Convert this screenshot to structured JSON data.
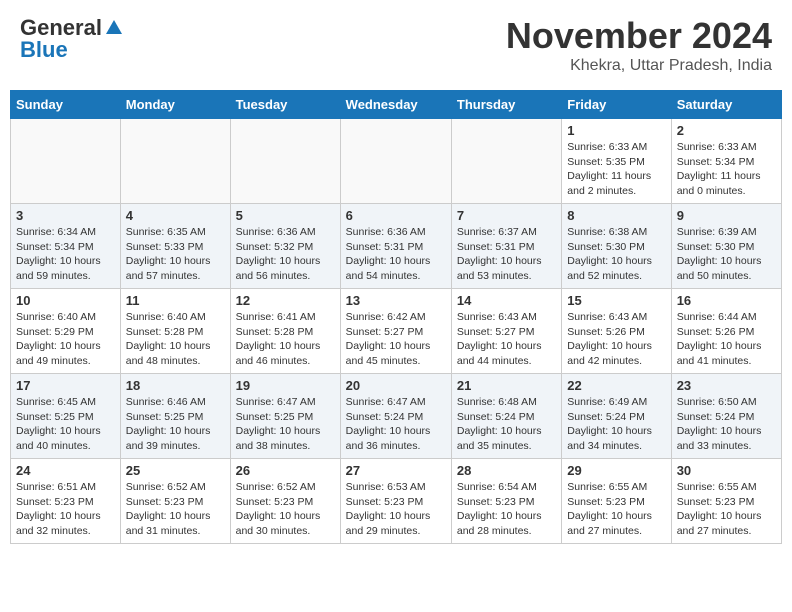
{
  "header": {
    "logo_line1": "General",
    "logo_line2": "Blue",
    "month": "November 2024",
    "location": "Khekra, Uttar Pradesh, India"
  },
  "weekdays": [
    "Sunday",
    "Monday",
    "Tuesday",
    "Wednesday",
    "Thursday",
    "Friday",
    "Saturday"
  ],
  "weeks": [
    [
      {
        "day": "",
        "info": ""
      },
      {
        "day": "",
        "info": ""
      },
      {
        "day": "",
        "info": ""
      },
      {
        "day": "",
        "info": ""
      },
      {
        "day": "",
        "info": ""
      },
      {
        "day": "1",
        "info": "Sunrise: 6:33 AM\nSunset: 5:35 PM\nDaylight: 11 hours and 2 minutes."
      },
      {
        "day": "2",
        "info": "Sunrise: 6:33 AM\nSunset: 5:34 PM\nDaylight: 11 hours and 0 minutes."
      }
    ],
    [
      {
        "day": "3",
        "info": "Sunrise: 6:34 AM\nSunset: 5:34 PM\nDaylight: 10 hours and 59 minutes."
      },
      {
        "day": "4",
        "info": "Sunrise: 6:35 AM\nSunset: 5:33 PM\nDaylight: 10 hours and 57 minutes."
      },
      {
        "day": "5",
        "info": "Sunrise: 6:36 AM\nSunset: 5:32 PM\nDaylight: 10 hours and 56 minutes."
      },
      {
        "day": "6",
        "info": "Sunrise: 6:36 AM\nSunset: 5:31 PM\nDaylight: 10 hours and 54 minutes."
      },
      {
        "day": "7",
        "info": "Sunrise: 6:37 AM\nSunset: 5:31 PM\nDaylight: 10 hours and 53 minutes."
      },
      {
        "day": "8",
        "info": "Sunrise: 6:38 AM\nSunset: 5:30 PM\nDaylight: 10 hours and 52 minutes."
      },
      {
        "day": "9",
        "info": "Sunrise: 6:39 AM\nSunset: 5:30 PM\nDaylight: 10 hours and 50 minutes."
      }
    ],
    [
      {
        "day": "10",
        "info": "Sunrise: 6:40 AM\nSunset: 5:29 PM\nDaylight: 10 hours and 49 minutes."
      },
      {
        "day": "11",
        "info": "Sunrise: 6:40 AM\nSunset: 5:28 PM\nDaylight: 10 hours and 48 minutes."
      },
      {
        "day": "12",
        "info": "Sunrise: 6:41 AM\nSunset: 5:28 PM\nDaylight: 10 hours and 46 minutes."
      },
      {
        "day": "13",
        "info": "Sunrise: 6:42 AM\nSunset: 5:27 PM\nDaylight: 10 hours and 45 minutes."
      },
      {
        "day": "14",
        "info": "Sunrise: 6:43 AM\nSunset: 5:27 PM\nDaylight: 10 hours and 44 minutes."
      },
      {
        "day": "15",
        "info": "Sunrise: 6:43 AM\nSunset: 5:26 PM\nDaylight: 10 hours and 42 minutes."
      },
      {
        "day": "16",
        "info": "Sunrise: 6:44 AM\nSunset: 5:26 PM\nDaylight: 10 hours and 41 minutes."
      }
    ],
    [
      {
        "day": "17",
        "info": "Sunrise: 6:45 AM\nSunset: 5:25 PM\nDaylight: 10 hours and 40 minutes."
      },
      {
        "day": "18",
        "info": "Sunrise: 6:46 AM\nSunset: 5:25 PM\nDaylight: 10 hours and 39 minutes."
      },
      {
        "day": "19",
        "info": "Sunrise: 6:47 AM\nSunset: 5:25 PM\nDaylight: 10 hours and 38 minutes."
      },
      {
        "day": "20",
        "info": "Sunrise: 6:47 AM\nSunset: 5:24 PM\nDaylight: 10 hours and 36 minutes."
      },
      {
        "day": "21",
        "info": "Sunrise: 6:48 AM\nSunset: 5:24 PM\nDaylight: 10 hours and 35 minutes."
      },
      {
        "day": "22",
        "info": "Sunrise: 6:49 AM\nSunset: 5:24 PM\nDaylight: 10 hours and 34 minutes."
      },
      {
        "day": "23",
        "info": "Sunrise: 6:50 AM\nSunset: 5:24 PM\nDaylight: 10 hours and 33 minutes."
      }
    ],
    [
      {
        "day": "24",
        "info": "Sunrise: 6:51 AM\nSunset: 5:23 PM\nDaylight: 10 hours and 32 minutes."
      },
      {
        "day": "25",
        "info": "Sunrise: 6:52 AM\nSunset: 5:23 PM\nDaylight: 10 hours and 31 minutes."
      },
      {
        "day": "26",
        "info": "Sunrise: 6:52 AM\nSunset: 5:23 PM\nDaylight: 10 hours and 30 minutes."
      },
      {
        "day": "27",
        "info": "Sunrise: 6:53 AM\nSunset: 5:23 PM\nDaylight: 10 hours and 29 minutes."
      },
      {
        "day": "28",
        "info": "Sunrise: 6:54 AM\nSunset: 5:23 PM\nDaylight: 10 hours and 28 minutes."
      },
      {
        "day": "29",
        "info": "Sunrise: 6:55 AM\nSunset: 5:23 PM\nDaylight: 10 hours and 27 minutes."
      },
      {
        "day": "30",
        "info": "Sunrise: 6:55 AM\nSunset: 5:23 PM\nDaylight: 10 hours and 27 minutes."
      }
    ]
  ]
}
